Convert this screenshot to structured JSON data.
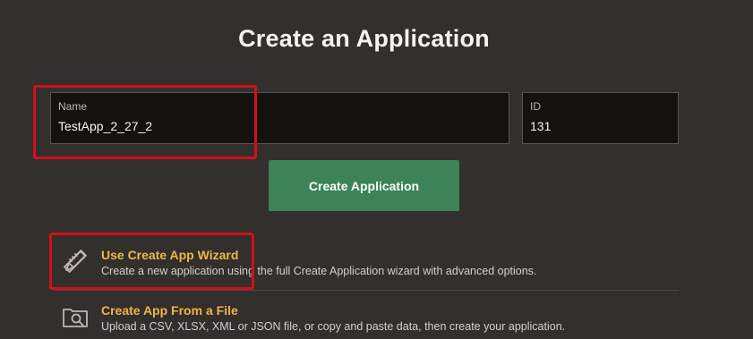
{
  "page": {
    "title": "Create an Application"
  },
  "form": {
    "name_label": "Name",
    "name_value": "TestApp_2_27_2",
    "id_label": "ID",
    "id_value": "131",
    "create_button": "Create Application"
  },
  "options": [
    {
      "title": "Use Create App Wizard",
      "description": "Create a new application using the full Create Application wizard with advanced options.",
      "icon": "ruler-pencil-icon"
    },
    {
      "title": "Create App From a File",
      "description": "Upload a CSV, XLSX, XML or JSON file, or copy and paste data, then create your application.",
      "icon": "file-search-icon"
    }
  ],
  "colors": {
    "background": "#322f2c",
    "accent_button": "#3c8358",
    "option_title": "#f0b549",
    "highlight": "#d2101a"
  }
}
